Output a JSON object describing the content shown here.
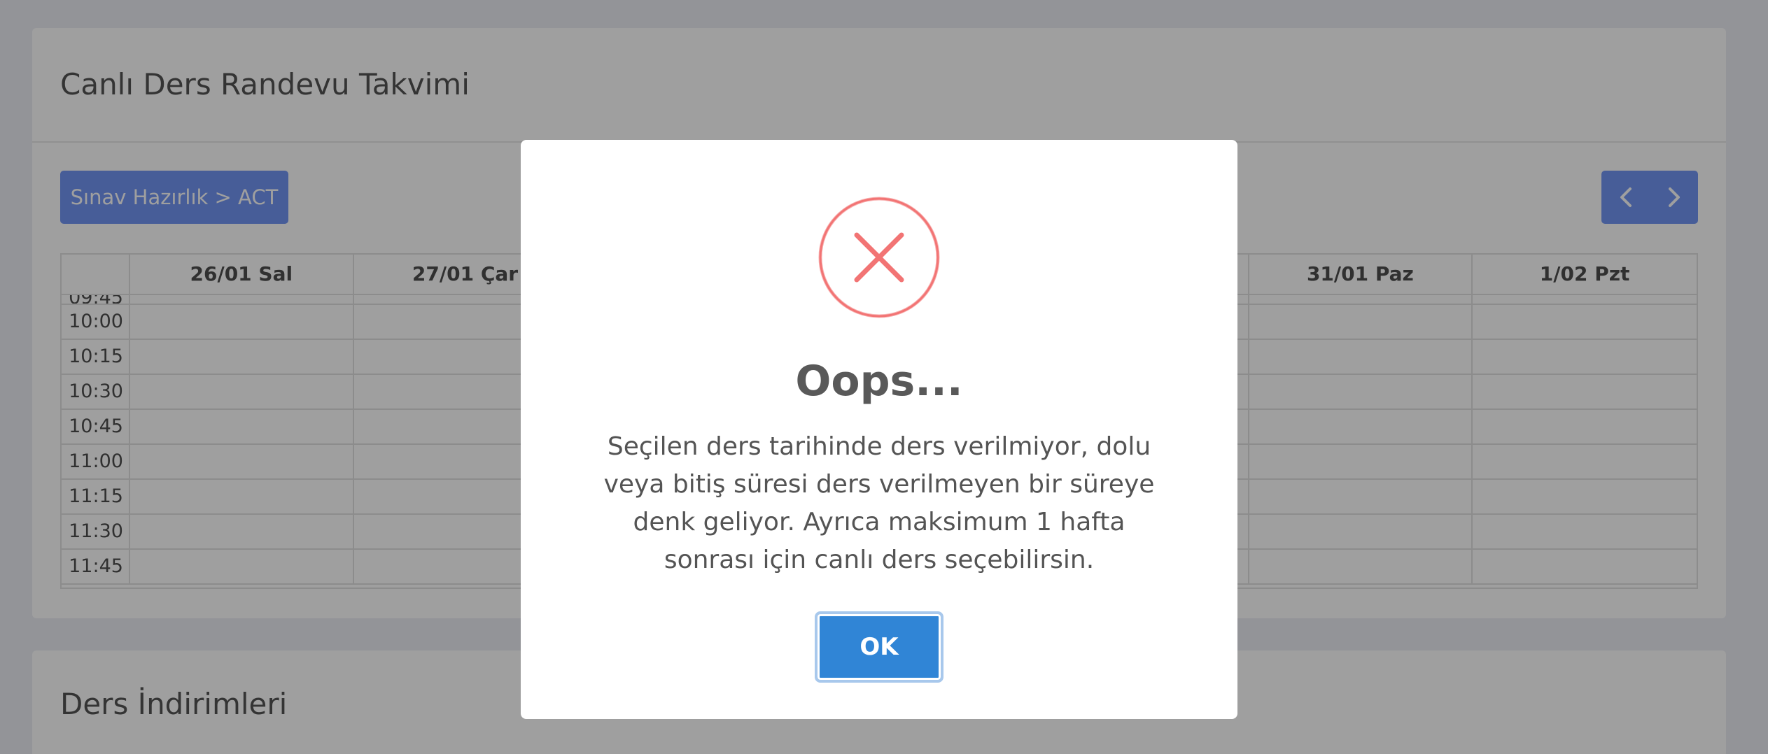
{
  "calendar": {
    "title": "Canlı Ders Randevu Takvimi",
    "course_button": "Sınav Hazırlık > ACT",
    "prev_icon": "chevron-left-icon",
    "next_icon": "chevron-right-icon",
    "days": [
      "26/01 Sal",
      "27/01 Çar",
      "",
      "",
      "",
      "31/01 Paz",
      "1/02 Pzt"
    ],
    "partial_time": "09:45",
    "times": [
      "10:00",
      "10:15",
      "10:30",
      "10:45",
      "11:00",
      "11:15",
      "11:30",
      "11:45"
    ]
  },
  "discounts": {
    "title": "Ders İndirimleri"
  },
  "dialog": {
    "icon": "error-x-icon",
    "title": "Oops...",
    "message": "Seçilen ders tarihinde ders verilmiyor, dolu veya bitiş süresi ders verilmeyen bir süreye denk geliyor. Ayrıca maksimum 1 hafta sonrası için canlı ders seçebilirsin.",
    "ok_label": "OK"
  },
  "colors": {
    "accent": "#5d86f2",
    "confirm": "#3085d6",
    "error": "#f27474"
  }
}
